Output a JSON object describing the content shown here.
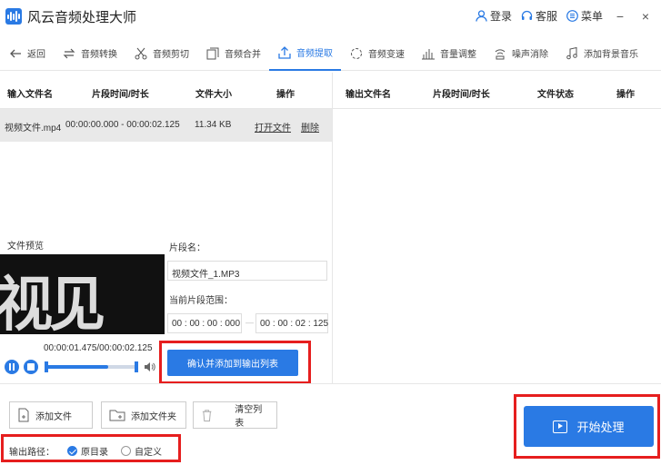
{
  "app": {
    "title": "风云音频处理大师",
    "brand_color": "#2a7ae4",
    "highlight_color": "#e61e1e"
  },
  "titlebar": {
    "login": "登录",
    "service": "客服",
    "menu": "菜单",
    "minimize": "−",
    "close": "×"
  },
  "toolbar": {
    "back": "返回",
    "items": [
      {
        "label": "音频转换",
        "icon": "convert-icon"
      },
      {
        "label": "音频剪切",
        "icon": "scissors-icon"
      },
      {
        "label": "音频合并",
        "icon": "merge-icon"
      },
      {
        "label": "音频提取",
        "icon": "extract-icon",
        "active": true
      },
      {
        "label": "音频变速",
        "icon": "speed-icon"
      },
      {
        "label": "音量调整",
        "icon": "volume-bars-icon"
      },
      {
        "label": "噪声消除",
        "icon": "noise-icon"
      },
      {
        "label": "添加背景音乐",
        "icon": "music-icon"
      }
    ]
  },
  "input_table": {
    "headers": [
      "输入文件名",
      "片段时间/时长",
      "文件大小",
      "操作"
    ],
    "rows": [
      {
        "name": "视频文件.mp4",
        "time": "00:00:00.000 - 00:00:02.125",
        "size": "11.34 KB",
        "open": "打开文件",
        "delete": "删除"
      }
    ]
  },
  "output_table": {
    "headers": [
      "输出文件名",
      "片段时间/时长",
      "文件状态",
      "操作"
    ]
  },
  "preview": {
    "label": "文件预览",
    "frame_text": "视见",
    "time_readout": "00:00:01.475/00:00:02.125",
    "progress": 0.69
  },
  "segment": {
    "name_label": "片段名：",
    "name_value": "视频文件_1.MP3",
    "range_label": "当前片段范围：",
    "start": "00 : 00 : 00 : 000",
    "end": "00 : 00 : 02 : 125",
    "confirm_button": "确认并添加到输出列表"
  },
  "bottom": {
    "add_file": "添加文件",
    "add_folder": "添加文件夹",
    "clear_list": "清空列表",
    "path_label": "输出路径：",
    "option_original": "原目录",
    "option_custom": "自定义",
    "start_button": "开始处理"
  }
}
